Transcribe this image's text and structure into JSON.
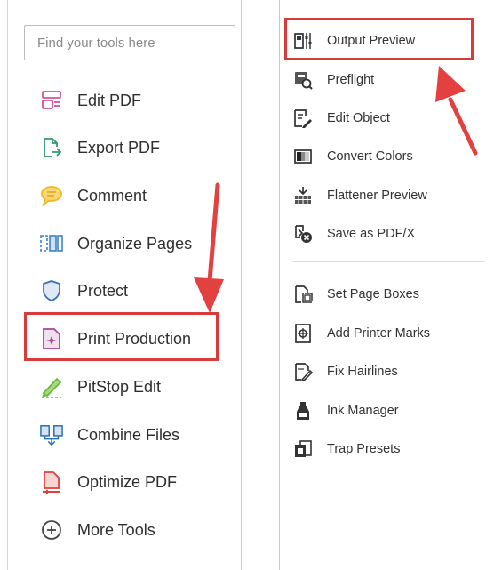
{
  "left_panel": {
    "search": {
      "placeholder": "Find your tools here"
    },
    "tools": [
      {
        "label": "Edit PDF",
        "icon": "edit-pdf-icon"
      },
      {
        "label": "Export PDF",
        "icon": "export-pdf-icon"
      },
      {
        "label": "Comment",
        "icon": "comment-icon"
      },
      {
        "label": "Organize Pages",
        "icon": "organize-pages-icon"
      },
      {
        "label": "Protect",
        "icon": "shield-icon"
      },
      {
        "label": "Print Production",
        "icon": "print-production-icon"
      },
      {
        "label": "PitStop Edit",
        "icon": "pitstop-pen-icon"
      },
      {
        "label": "Combine Files",
        "icon": "combine-files-icon"
      },
      {
        "label": "Optimize PDF",
        "icon": "optimize-pdf-icon"
      },
      {
        "label": "More Tools",
        "icon": "plus-circle-icon"
      }
    ]
  },
  "right_panel": {
    "group1": [
      {
        "label": "Output Preview",
        "icon": "output-preview-icon"
      },
      {
        "label": "Preflight",
        "icon": "preflight-icon"
      },
      {
        "label": "Edit Object",
        "icon": "edit-object-icon"
      },
      {
        "label": "Convert Colors",
        "icon": "convert-colors-icon"
      },
      {
        "label": "Flattener Preview",
        "icon": "flattener-preview-icon"
      },
      {
        "label": "Save as PDF/X",
        "icon": "save-pdfx-icon"
      }
    ],
    "group2": [
      {
        "label": "Set Page Boxes",
        "icon": "set-page-boxes-icon"
      },
      {
        "label": "Add Printer Marks",
        "icon": "printer-marks-icon"
      },
      {
        "label": "Fix Hairlines",
        "icon": "fix-hairlines-icon"
      },
      {
        "label": "Ink Manager",
        "icon": "ink-manager-icon"
      },
      {
        "label": "Trap Presets",
        "icon": "trap-presets-icon"
      }
    ]
  },
  "colors": {
    "highlight": "#d93a3a",
    "edit_pdf": "#d4519b",
    "export_pdf": "#2e9b6a",
    "comment": "#f2b822",
    "organize": "#3a84c9",
    "protect": "#3d6fb6",
    "print_production": "#a9469a",
    "pitstop": "#6cbc3b",
    "combine": "#2c6fb7",
    "optimize": "#e0403a"
  }
}
